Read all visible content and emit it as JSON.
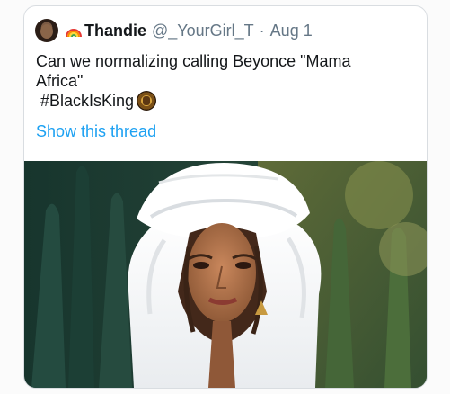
{
  "tweet": {
    "display_name": "Thandie",
    "handle": "@_YourGirl_T",
    "separator": "·",
    "date": "Aug 1",
    "text_line1": "Can we normalizing calling Beyonce \"Mama",
    "text_line2": "Africa\"",
    "hashtag": "#BlackIsKing",
    "show_thread_label": "Show this thread"
  },
  "icons": {
    "avatar": "profile-avatar",
    "rainbow": "rainbow-emoji",
    "crest": "blackisking-crest-icon"
  },
  "colors": {
    "text": "#14171a",
    "muted": "#657786",
    "link": "#1da1f2",
    "border": "#d9dde1"
  }
}
